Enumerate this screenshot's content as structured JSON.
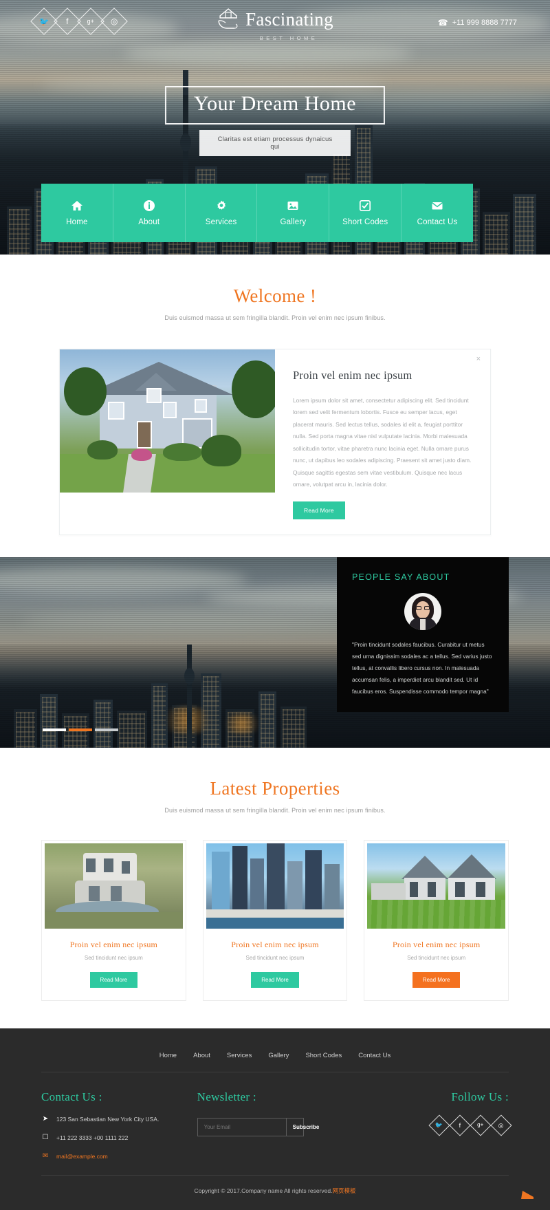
{
  "header": {
    "logo_name": "Fascinating",
    "logo_sub": "Best Home",
    "phone": "+11 999 8888 7777",
    "social": [
      {
        "name": "twitter-icon",
        "glyph": "🐦"
      },
      {
        "name": "facebook-icon",
        "glyph": "f"
      },
      {
        "name": "google-plus-icon",
        "glyph": "g+"
      },
      {
        "name": "dribbble-icon",
        "glyph": "◎"
      }
    ]
  },
  "hero": {
    "title": "Your Dream Home",
    "subtitle": "Claritas est etiam processus dynaicus qui"
  },
  "nav": {
    "items": [
      {
        "label": "Home",
        "icon": "home-icon"
      },
      {
        "label": "About",
        "icon": "info-icon"
      },
      {
        "label": "Services",
        "icon": "gear-icon"
      },
      {
        "label": "Gallery",
        "icon": "image-icon"
      },
      {
        "label": "Short Codes",
        "icon": "check-square-icon"
      },
      {
        "label": "Contact Us",
        "icon": "envelope-icon"
      }
    ]
  },
  "welcome": {
    "title": "Welcome !",
    "subtitle": "Duis euismod massa ut sem fringilla blandit. Proin vel enim nec ipsum finibus.",
    "card_title": "Proin vel enim nec ipsum",
    "card_text": "Lorem ipsum dolor sit amet, consectetur adipiscing elit. Sed tincidunt lorem sed velit fermentum lobortis. Fusce eu semper lacus, eget placerat mauris. Sed lectus tellus, sodales id elit a, feugiat porttitor nulla. Sed porta magna vitae nisl vulputate lacinia. Morbi malesuada sollicitudin tortor, vitae pharetra nunc lacinia eget. Nulla ornare purus nunc, ut dapibus leo sodales adipiscing. Praesent sit amet justo diam. Quisque sagittis egestas sem vitae vestibulum. Quisque nec lacus ornare, volutpat arcu in, lacinia dolor.",
    "read_more": "Read More",
    "close": "×"
  },
  "testimonial": {
    "heading": "PEOPLE SAY ABOUT",
    "quote": "\"Proin tincidunt sodales faucibus. Curabitur ut metus sed urna dignissim sodales ac a tellus. Sed varius justo tellus, at convallis libero cursus non. In malesuada accumsan felis, a imperdiet arcu blandit sed. Ut id faucibus eros. Suspendisse commodo tempor magna\"",
    "slides": [
      1,
      2,
      3
    ]
  },
  "latest": {
    "title": "Latest Properties",
    "subtitle": "Duis euismod massa ut sem fringilla blandit. Proin vel enim nec ipsum finibus.",
    "cards": [
      {
        "title": "Proin vel enim nec ipsum",
        "caption": "Sed tincidunt nec ipsum",
        "button": "Read More",
        "accent": "#2ec9a0"
      },
      {
        "title": "Proin vel enim nec ipsum",
        "caption": "Sed tincidunt nec ipsum",
        "button": "Read More",
        "accent": "#2ec9a0"
      },
      {
        "title": "Proin vel enim nec ipsum",
        "caption": "Sed tincidunt nec ipsum",
        "button": "Read More",
        "accent": "#f4711f"
      }
    ]
  },
  "footer": {
    "nav": [
      "Home",
      "About",
      "Services",
      "Gallery",
      "Short Codes",
      "Contact Us"
    ],
    "contact_heading": "Contact Us :",
    "address": "123 San Sebastian New York City USA.",
    "phone": "+11 222 3333 +00 1111 222",
    "email": "mail@example.com",
    "newsletter_heading": "Newsletter :",
    "email_placeholder": "Your Email",
    "subscribe": "Subscribe",
    "follow_heading": "Follow Us :",
    "social": [
      {
        "name": "twitter-icon",
        "glyph": "🐦"
      },
      {
        "name": "facebook-icon",
        "glyph": "f"
      },
      {
        "name": "google-plus-icon",
        "glyph": "g+"
      },
      {
        "name": "dribbble-icon",
        "glyph": "◎"
      }
    ],
    "copyright_pre": "Copyright © 2017.Company name All rights reserved.",
    "copyright_link": "网页模板",
    "to_top": "➤"
  },
  "colors": {
    "teal": "#2ec9a0",
    "orange": "#ef7622",
    "orange_btn": "#f4711f",
    "footer_bg": "#2b2b2b"
  }
}
